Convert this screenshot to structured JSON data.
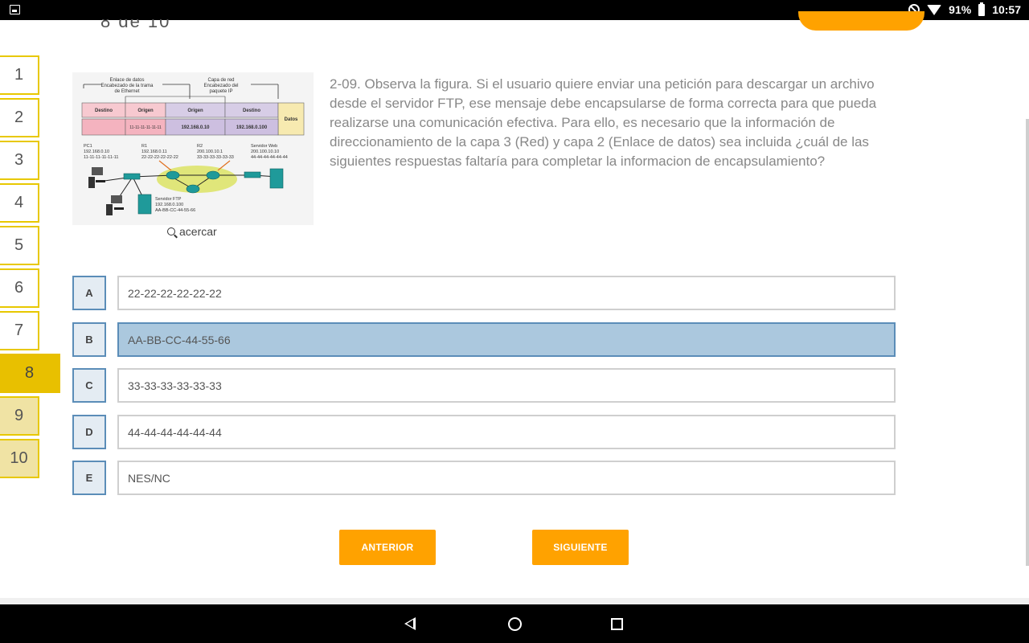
{
  "status_bar": {
    "battery": "91%",
    "time": "10:57"
  },
  "header": {
    "partial_text": "8 de 10"
  },
  "question_nav": {
    "items": [
      "1",
      "2",
      "3",
      "4",
      "5",
      "6",
      "7",
      "8",
      "9",
      "10"
    ],
    "current": "8"
  },
  "figure": {
    "top_labels": {
      "left": "Enlace de datos\nEncabezado de la trama\nde Ethernet",
      "right": "Capa de red\nEncabezado del\npaquete IP"
    },
    "header_cells": [
      "Destino",
      "Origen",
      "Origen",
      "Destino",
      "Datos"
    ],
    "value_cells": [
      "",
      "11-11-11-11-11-11",
      "192.168.0.10",
      "192.168.0.100"
    ],
    "devices": {
      "pc1": [
        "PC1",
        "192.168.0.10",
        "11-11-11-11-11-11"
      ],
      "r1": [
        "R1",
        "192.168.0.11",
        "22-22-22-22-22-22"
      ],
      "r2": [
        "R2",
        "200.100.10.1",
        "33-33-33-33-33-33"
      ],
      "web": [
        "Servidor Web",
        "200.100.10.10",
        "44-44-44-44-44-44"
      ],
      "ftp": [
        "Servidor FTP",
        "192.168.0.100",
        "AA-BB-CC-44-55-66"
      ]
    },
    "zoom_label": "acercar"
  },
  "question": {
    "text": "2-09. Observa la figura. Si el usuario quiere enviar una petición para descargar un archivo desde el servidor FTP, ese mensaje debe encapsularse de forma correcta para que pueda realizarse una comunicación efectiva. Para ello, es necesario que la información de direccionamiento de la capa 3 (Red) y capa 2 (Enlace de datos) sea incluida ¿cuál de las siguientes respuestas faltaría para completar la informacion de encapsulamiento?"
  },
  "options": [
    {
      "letter": "A",
      "text": "22-22-22-22-22-22"
    },
    {
      "letter": "B",
      "text": "AA-BB-CC-44-55-66"
    },
    {
      "letter": "C",
      "text": "33-33-33-33-33-33"
    },
    {
      "letter": "D",
      "text": "44-44-44-44-44-44"
    },
    {
      "letter": "E",
      "text": "NES/NC"
    }
  ],
  "selected_option": "B",
  "buttons": {
    "previous": "ANTERIOR",
    "next": "SIGUIENTE"
  },
  "colors": {
    "accent": "#ffa200",
    "nav_active": "#e8c000",
    "selected": "#abc8de",
    "letter_border": "#5b8db8"
  }
}
